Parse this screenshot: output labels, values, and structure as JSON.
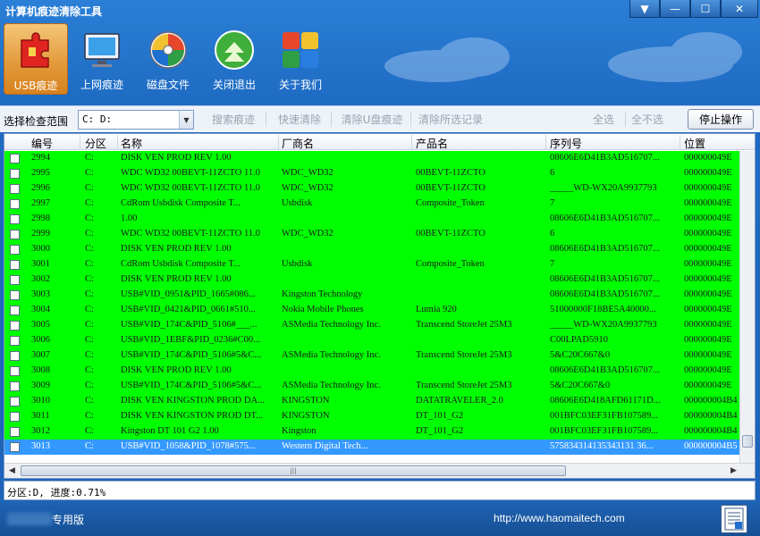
{
  "window": {
    "title": "计算机痕迹清除工具",
    "controls": [
      "▼",
      "—",
      "☐",
      "✕"
    ]
  },
  "toolbar": {
    "items": [
      {
        "label": "USB痕迹",
        "icon": "usb-puzzle-icon"
      },
      {
        "label": "上网痕迹",
        "icon": "monitor-network-icon"
      },
      {
        "label": "磁盘文件",
        "icon": "disk-file-icon"
      },
      {
        "label": "关闭退出",
        "icon": "exit-arrow-icon"
      },
      {
        "label": "关于我们",
        "icon": "about-tiles-icon"
      }
    ]
  },
  "filter": {
    "scope_label": "选择检查范围",
    "scope_value": "C: D:",
    "search_btn": "搜索痕迹",
    "quick_clean_btn": "快速清除",
    "clean_usb_btn": "清除U盘痕迹",
    "clear_selected_btn": "清除所选记录",
    "select_all_btn": "全选",
    "select_none_btn": "全不选",
    "stop_btn": "停止操作"
  },
  "grid": {
    "columns": [
      "编号",
      "分区",
      "名称",
      "厂商名",
      "产品名",
      "序列号",
      "位置"
    ],
    "rows": [
      [
        "2994",
        "C:",
        "DISK VEN PROD REV 1.00",
        "",
        "",
        "08606E6D41B3AD516707...",
        "000000049E"
      ],
      [
        "2995",
        "C:",
        "WDC WD32 00BEVT-11ZCTO 11.0",
        "WDC_WD32",
        "00BEVT-11ZCTO",
        "6",
        "000000049E"
      ],
      [
        "2996",
        "C:",
        "WDC WD32 00BEVT-11ZCTO 11.0",
        "WDC_WD32",
        "00BEVT-11ZCTO",
        "_____WD-WX20A9937793",
        "000000049E"
      ],
      [
        "2997",
        "C:",
        "CdRom Usbdisk Composite T...",
        "Usbdisk",
        "Composite_Token",
        "7",
        "000000049E"
      ],
      [
        "2998",
        "C:",
        " 1.00",
        "",
        "",
        "08606E6D41B3AD516707...",
        "000000049E"
      ],
      [
        "2999",
        "C:",
        "WDC WD32 00BEVT-11ZCTO 11.0",
        "WDC_WD32",
        "00BEVT-11ZCTO",
        "6",
        "000000049E"
      ],
      [
        "3000",
        "C:",
        "DISK VEN PROD REV 1.00",
        "",
        "",
        "08606E6D41B3AD516707...",
        "000000049E"
      ],
      [
        "3001",
        "C:",
        "CdRom Usbdisk Composite T...",
        "Usbdisk",
        "Composite_Token",
        "7",
        "000000049E"
      ],
      [
        "3002",
        "C:",
        "DISK VEN PROD REV 1.00",
        "",
        "",
        "08606E6D41B3AD516707...",
        "000000049E"
      ],
      [
        "3003",
        "C:",
        "USB#VID_0951&PID_1665#086...",
        "Kingston Technology",
        "",
        "08606E6D41B3AD516707...",
        "000000049E"
      ],
      [
        "3004",
        "C:",
        "USB#VID_0421&PID_0661#510...",
        "Nokia Mobile Phones",
        "Lumia 920",
        "51000000F18BE5A40000...",
        "000000049E"
      ],
      [
        "3005",
        "C:",
        "USB#VID_174C&PID_5106#___...",
        "ASMedia Technology Inc.",
        "Transcend StoreJet 25M3",
        "_____WD-WX20A9937793",
        "000000049E"
      ],
      [
        "3006",
        "C:",
        "USB#VID_1EBF&PID_0236#C00...",
        "",
        "",
        "C00LPAD5910",
        "000000049E"
      ],
      [
        "3007",
        "C:",
        "USB#VID_174C&PID_5106#5&C...",
        "ASMedia Technology Inc.",
        "Transcend StoreJet 25M3",
        "5&C20C667&0",
        "000000049E"
      ],
      [
        "3008",
        "C:",
        "DISK VEN PROD REV 1.00",
        "",
        "",
        "08606E6D41B3AD516707...",
        "000000049E"
      ],
      [
        "3009",
        "C:",
        "USB#VID_174C&PID_5106#5&C...",
        "ASMedia Technology Inc.",
        "Transcend StoreJet 25M3",
        "5&C20C667&0",
        "000000049E"
      ],
      [
        "3010",
        "C:",
        "DISK VEN KINGSTON PROD DA...",
        "KINGSTON",
        "DATATRAVELER_2.0",
        "08606E6D418AFD61171D...",
        "000000004B4"
      ],
      [
        "3011",
        "C:",
        "DISK VEN KINGSTON PROD DT...",
        "KINGSTON",
        "DT_101_G2",
        "001BFC03EF31FB107589...",
        "000000004B4"
      ],
      [
        "3012",
        "C:",
        "Kingston DT 101 G2 1.00",
        "Kingston",
        "DT_101_G2",
        "001BFC03EF31FB107589...",
        "000000004B4"
      ],
      [
        "3013",
        "C:",
        "USB#VID_1058&PID_1078#575...",
        "Western Digital Tech...",
        "",
        "575834314135343131 36...",
        "000000004B5"
      ]
    ],
    "selected_index": 19,
    "row_color": "#00ff00",
    "selected_color": "#3399ff"
  },
  "status": {
    "text": "分区:D, 进度:0.71%"
  },
  "footer": {
    "edition": "专用版",
    "url": "http://www.haomaitech.com"
  }
}
